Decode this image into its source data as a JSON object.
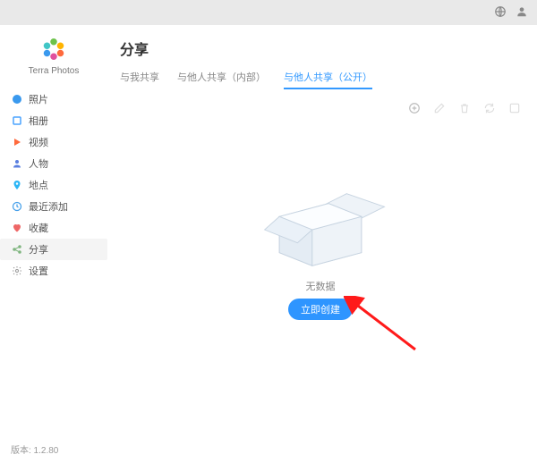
{
  "app": {
    "name": "Terra Photos",
    "version_label": "版本: 1.2.80"
  },
  "topbar": {
    "globe_icon": "globe",
    "user_icon": "user"
  },
  "sidebar": {
    "items": [
      {
        "id": "photos",
        "label": "照片",
        "icon": "image",
        "color": "#3a99ee"
      },
      {
        "id": "albums",
        "label": "相册",
        "icon": "album",
        "color": "#4aa3ff"
      },
      {
        "id": "videos",
        "label": "视频",
        "icon": "play",
        "color": "#ff6a3d"
      },
      {
        "id": "people",
        "label": "人物",
        "icon": "person",
        "color": "#5a7fe0"
      },
      {
        "id": "places",
        "label": "地点",
        "icon": "pin",
        "color": "#2bb6f6"
      },
      {
        "id": "recent",
        "label": "最近添加",
        "icon": "clock",
        "color": "#46a0ea"
      },
      {
        "id": "fav",
        "label": "收藏",
        "icon": "heart",
        "color": "#e66"
      },
      {
        "id": "share",
        "label": "分享",
        "icon": "share",
        "color": "#7fb57f",
        "active": true
      },
      {
        "id": "settings",
        "label": "设置",
        "icon": "gear",
        "color": "#999"
      }
    ]
  },
  "main": {
    "title": "分享",
    "tabs": [
      {
        "id": "with_me",
        "label": "与我共享"
      },
      {
        "id": "with_others_int",
        "label": "与他人共享（内部）"
      },
      {
        "id": "with_others_pub",
        "label": "与他人共享（公开）",
        "active": true
      }
    ],
    "toolbar": {
      "add": "add",
      "edit": "edit",
      "delete": "delete",
      "refresh": "refresh",
      "more": "more"
    },
    "empty": {
      "text": "无数据",
      "create_label": "立即创建"
    }
  }
}
